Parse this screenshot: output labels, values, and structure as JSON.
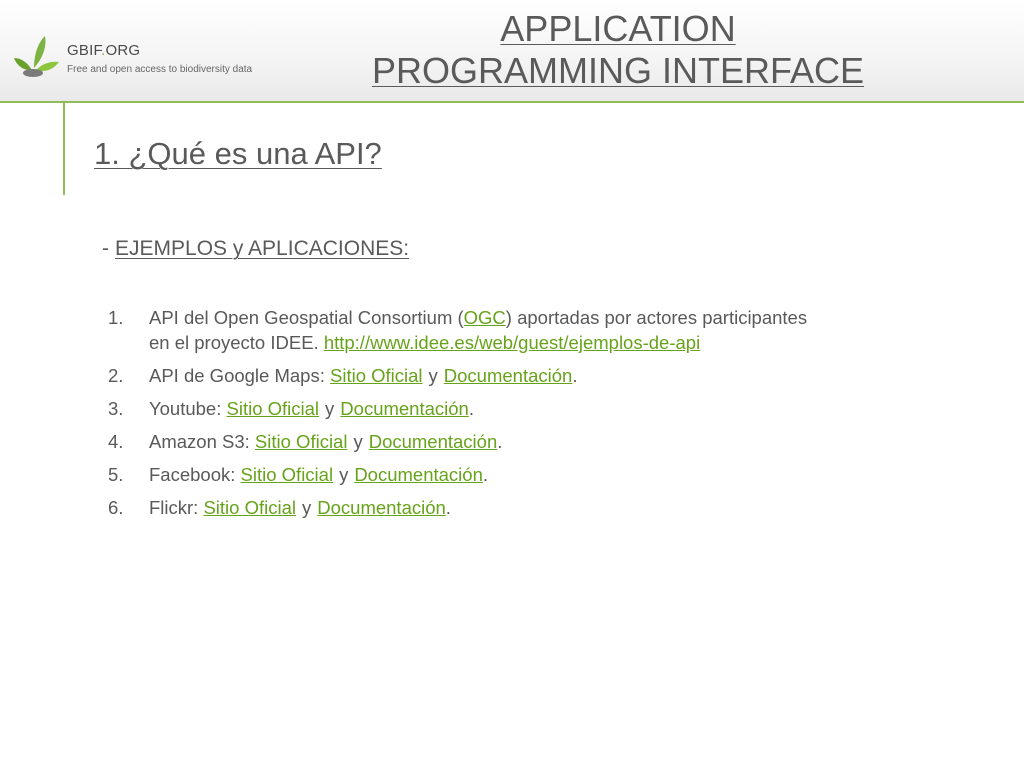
{
  "header": {
    "brand_name": "GBIF",
    "brand_dot": ".",
    "brand_suffix": "ORG",
    "brand_tagline": "Free and open access to biodiversity data",
    "logo_label": "GBIF",
    "title_line1": "APPLICATION",
    "title_line2": "PROGRAMMING INTERFACE"
  },
  "section_title": "1. ¿Qué es una API?",
  "subtitle": {
    "dash": "-",
    "text": "EJEMPLOS y APLICACIONES:"
  },
  "items": [
    {
      "num": "1.",
      "pre": "API del Open Geospatial Consortium (",
      "link1": "OGC",
      "post": ") aportadas por actores participantes",
      "line2": "en el proyecto IDEE. ",
      "url": "http://www.idee.es/web/guest/ejemplos-de-api"
    },
    {
      "num": "2.",
      "label": "API de Google Maps: ",
      "site": "Sitio Oficial",
      "and": "y",
      "doc": "Documentación",
      "end": "."
    },
    {
      "num": "3.",
      "label": "Youtube: ",
      "site": "Sitio Oficial",
      "and": "y",
      "doc": "Documentación",
      "end": "."
    },
    {
      "num": "4.",
      "label": "Amazon S3: ",
      "site": "Sitio Oficial",
      "and": "y",
      "doc": "Documentación",
      "end": "."
    },
    {
      "num": "5.",
      "label": "Facebook: ",
      "site": "Sitio Oficial",
      "and": "y",
      "doc": "Documentación",
      "end": "."
    },
    {
      "num": "6.",
      "label": "Flickr: ",
      "site": "Sitio Oficial",
      "and": "y",
      "doc": "Documentación",
      "end": "."
    }
  ],
  "colors": {
    "accent": "#8dbd52",
    "link": "#67a31a",
    "text": "#595959"
  }
}
